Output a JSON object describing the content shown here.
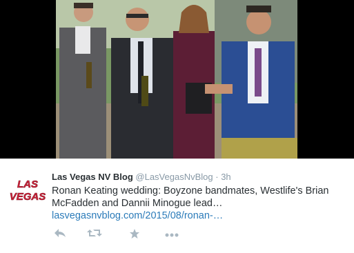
{
  "tweet": {
    "author_name": "Las Vegas NV Blog",
    "author_handle": "@LasVegasNvBlog",
    "separator": "·",
    "time": "3h",
    "text_line1": "Ronan Keating wedding: Boyzone bandmates, Westlife's Brian",
    "text_line2": "McFadden and Dannii Minogue lead…",
    "link": "lasvegasnvblog.com/2015/08/ronan-…"
  },
  "avatar": {
    "logo_text_top": "LAS",
    "logo_text_bottom": "VEGAS",
    "logo_color": "#d7263d"
  },
  "actions": {
    "reply_icon": "reply-icon",
    "retweet_icon": "retweet-icon",
    "favorite_icon": "star-icon",
    "more_icon": "more-icon"
  },
  "colors": {
    "name": "#292f33",
    "handle": "#8899a6",
    "link": "#2b7bb9",
    "action_icons": "#aab8c2"
  }
}
